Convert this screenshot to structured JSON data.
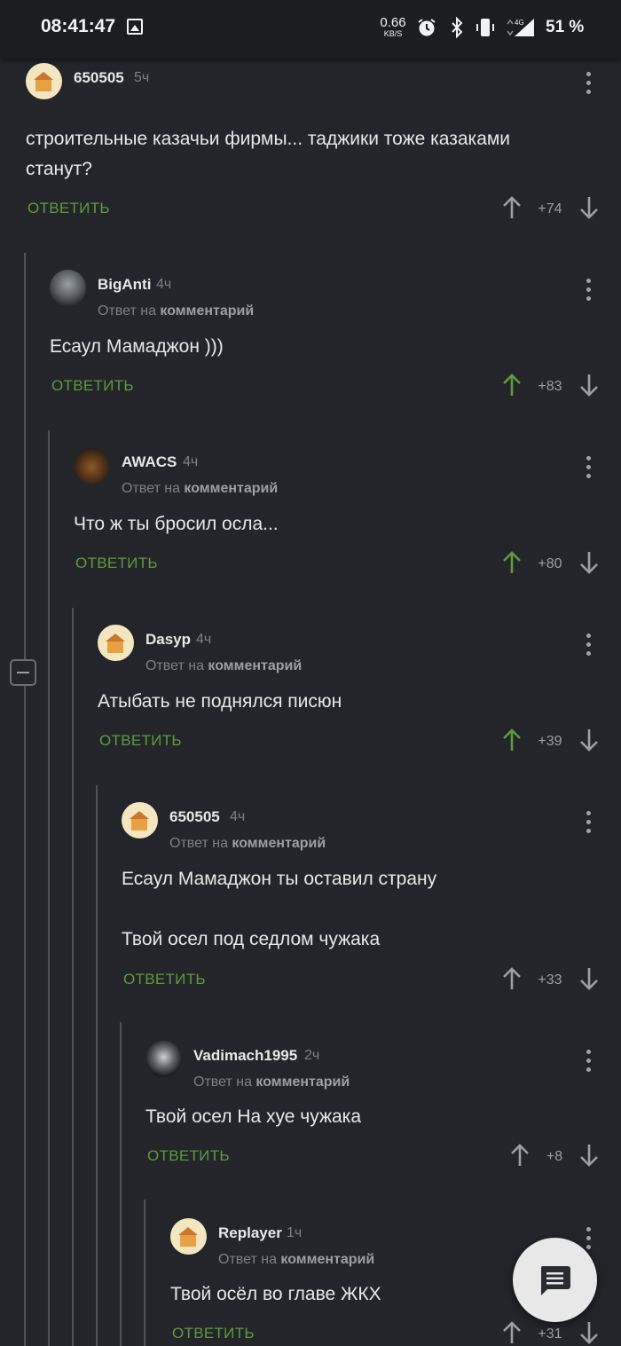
{
  "status_bar": {
    "time": "08:41:47",
    "net_speed_value": "0.66",
    "net_speed_unit": "KB/S",
    "network_type": "4G",
    "battery": "51 %"
  },
  "reply_label": "ОТВЕТИТЬ",
  "reply_to_prefix": "Ответ на",
  "reply_to_target": "комментарий",
  "comments": [
    {
      "author": "650505",
      "time": "5ч",
      "lines": [
        "строительные казачьи фирмы... таджики тоже казаками",
        "станут?"
      ],
      "rating": "+74",
      "upvoted": false
    },
    {
      "author": "BigAnti",
      "time": "4ч",
      "lines": [
        "Есаул Мамаджон )))"
      ],
      "rating": "+83",
      "upvoted": true
    },
    {
      "author": "AWACS",
      "time": "4ч",
      "lines": [
        "Что ж ты бросил осла..."
      ],
      "rating": "+80",
      "upvoted": true
    },
    {
      "author": "Dasyp",
      "time": "4ч",
      "lines": [
        "Атыбать не поднялся писюн"
      ],
      "rating": "+39",
      "upvoted": true
    },
    {
      "author": "650505",
      "time": "4ч",
      "lines": [
        "Есаул Мамаджон  ты оставил страну",
        "",
        "Твой осел под седлом чужака"
      ],
      "rating": "+33",
      "upvoted": false
    },
    {
      "author": "Vadimach1995",
      "time": "2ч",
      "lines": [
        "Твой осел На хуе чужака"
      ],
      "rating": "+8",
      "upvoted": false
    },
    {
      "author": "Replayer",
      "time": "1ч",
      "lines": [
        "Твой осёл во главе ЖКХ"
      ],
      "rating": "+31",
      "upvoted": false
    }
  ],
  "colors": {
    "upvote_active": "#5e9b3d",
    "vote_inactive": "#9c9fa5",
    "reply": "#5e9b3d"
  }
}
